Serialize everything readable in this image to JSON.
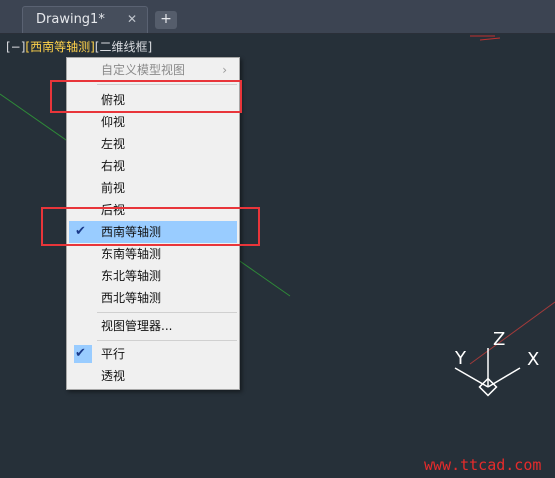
{
  "tab": {
    "title": "Drawing1*",
    "close_glyph": "✕",
    "new_tab_glyph": "+"
  },
  "viewport_controls": {
    "minus": "[−]",
    "view": "[西南等轴测]",
    "style": "[二维线框]"
  },
  "context_menu": {
    "items": [
      {
        "label": "自定义模型视图",
        "disabled": true,
        "submenu": true
      },
      {
        "label": "俯视"
      },
      {
        "label": "仰视"
      },
      {
        "label": "左视"
      },
      {
        "label": "右视"
      },
      {
        "label": "前视"
      },
      {
        "label": "后视"
      },
      {
        "label": "西南等轴测",
        "checked": true,
        "selected": true
      },
      {
        "label": "东南等轴测"
      },
      {
        "label": "东北等轴测"
      },
      {
        "label": "西北等轴测"
      },
      {
        "label": "视图管理器..."
      },
      {
        "label": "平行",
        "checked": true
      },
      {
        "label": "透视"
      }
    ]
  },
  "ucs_icon": {
    "x_label": "X",
    "y_label": "Y",
    "z_label": "Z"
  },
  "watermark": "www.ttcad.com",
  "colors": {
    "highlight": "#e8353a",
    "viewport_bg": "#263039",
    "menu_selected": "#99ccff",
    "view_label": "#ffd24a"
  },
  "icons": {
    "checkmark": "checkmark-icon",
    "submenu_arrow": "chevron-right-icon",
    "close": "close-icon"
  }
}
